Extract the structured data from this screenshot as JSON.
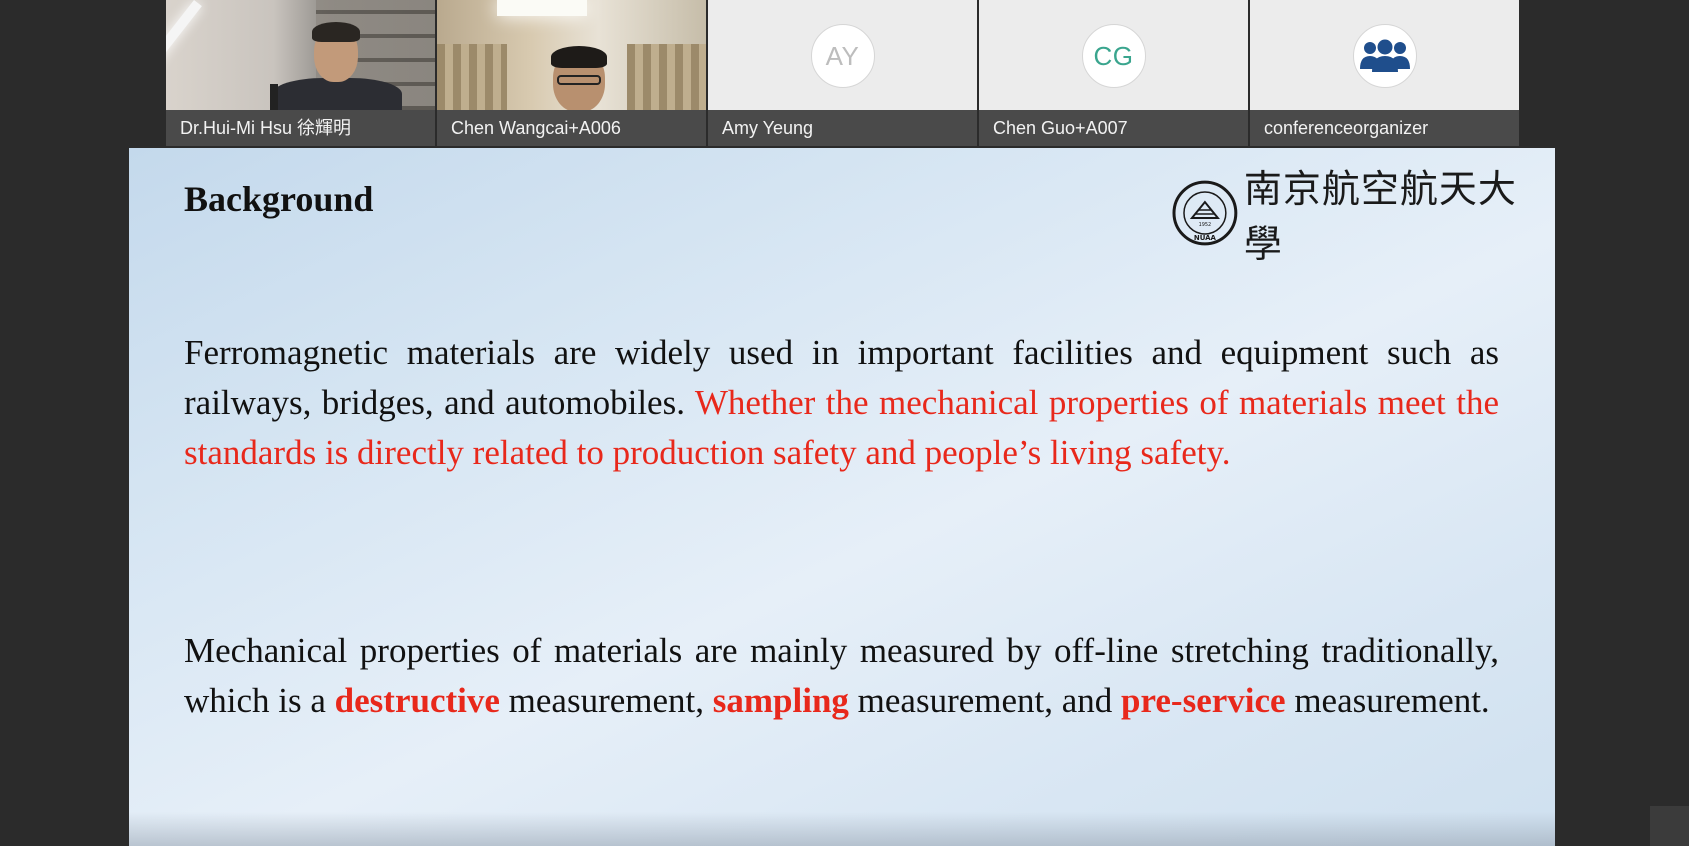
{
  "participants": [
    {
      "name": "Dr.Hui-Mi Hsu 徐輝明",
      "kind": "video"
    },
    {
      "name": "Chen Wangcai+A006",
      "kind": "video"
    },
    {
      "name": "Amy Yeung",
      "kind": "avatar",
      "initials": "AY",
      "initials_color": "#bdbdbd"
    },
    {
      "name": "Chen Guo+A007",
      "kind": "avatar",
      "initials": "CG",
      "initials_color": "#3aa58e"
    },
    {
      "name": "conferenceorganizer",
      "kind": "group-avatar",
      "icon": "group-people-icon",
      "icon_color": "#1f4e8c"
    }
  ],
  "slide": {
    "title": "Background",
    "logo_text": "南京航空航天大學",
    "logo_seal_abbrev": "NUAA",
    "logo_seal_year": "1952",
    "paragraph1": {
      "plain": "Ferromagnetic materials are widely used in important facilities and equipment such as railways, bridges, and automobiles. ",
      "highlight": "Whether the mechanical properties of materials meet the standards is directly related to production safety and people’s living safety."
    },
    "paragraph2": {
      "part1": "Mechanical properties of materials are mainly measured by off-line stretching traditionally, which is a ",
      "em1": "destructive",
      "part2": " measurement, ",
      "em2": "sampling",
      "part3": " measurement, and ",
      "em3": "pre-service",
      "part4": " measurement."
    },
    "colors": {
      "highlight": "#e8281b",
      "text": "#111111"
    }
  }
}
